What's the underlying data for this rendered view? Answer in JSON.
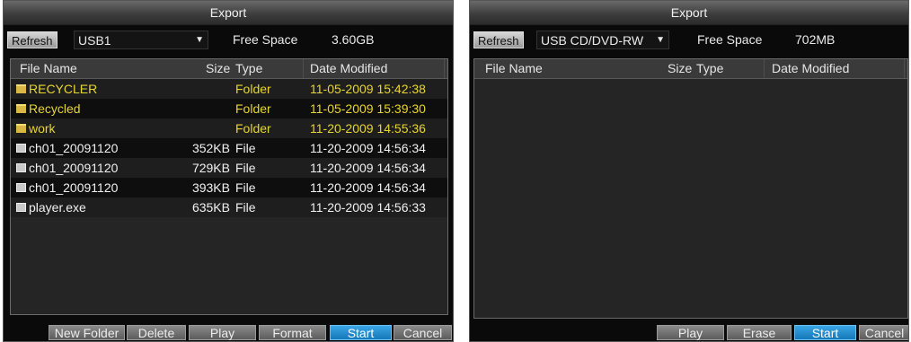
{
  "left": {
    "title": "Export",
    "refresh_label": "Refresh",
    "device": "USB1",
    "free_space_label": "Free Space",
    "free_space_value": "3.60GB",
    "columns": {
      "name": "File Name",
      "size": "Size",
      "type": "Type",
      "date": "Date Modified"
    },
    "files": [
      {
        "name": "RECYCLER",
        "size": "",
        "type": "Folder",
        "date": "11-05-2009 15:42:38",
        "icon": "folder-icon"
      },
      {
        "name": "Recycled",
        "size": "",
        "type": "Folder",
        "date": "11-05-2009 15:39:30",
        "icon": "folder-icon"
      },
      {
        "name": "work",
        "size": "",
        "type": "Folder",
        "date": "11-20-2009 14:55:36",
        "icon": "folder-icon"
      },
      {
        "name": "ch01_20091120",
        "size": "352KB",
        "type": "File",
        "date": "11-20-2009 14:56:34",
        "icon": "file-icon"
      },
      {
        "name": "ch01_20091120",
        "size": "729KB",
        "type": "File",
        "date": "11-20-2009 14:56:34",
        "icon": "file-icon"
      },
      {
        "name": "ch01_20091120",
        "size": "393KB",
        "type": "File",
        "date": "11-20-2009 14:56:34",
        "icon": "file-icon"
      },
      {
        "name": "player.exe",
        "size": "635KB",
        "type": "File",
        "date": "11-20-2009 14:56:33",
        "icon": "file-icon"
      }
    ],
    "buttons": [
      "New Folder",
      "Delete",
      "Play",
      "Format",
      "Start",
      "Cancel"
    ]
  },
  "right": {
    "title": "Export",
    "refresh_label": "Refresh",
    "device": "USB CD/DVD-RW",
    "free_space_label": "Free Space",
    "free_space_value": "702MB",
    "columns": {
      "name": "File Name",
      "size": "Size",
      "type": "Type",
      "date": "Date Modified"
    },
    "files": [],
    "buttons": [
      "Play",
      "Erase",
      "Start",
      "Cancel"
    ]
  },
  "colors": {
    "folder_text": "#e7d531",
    "primary_button": "#1f8fd6",
    "dialog_bg": "#0a0a0a"
  }
}
